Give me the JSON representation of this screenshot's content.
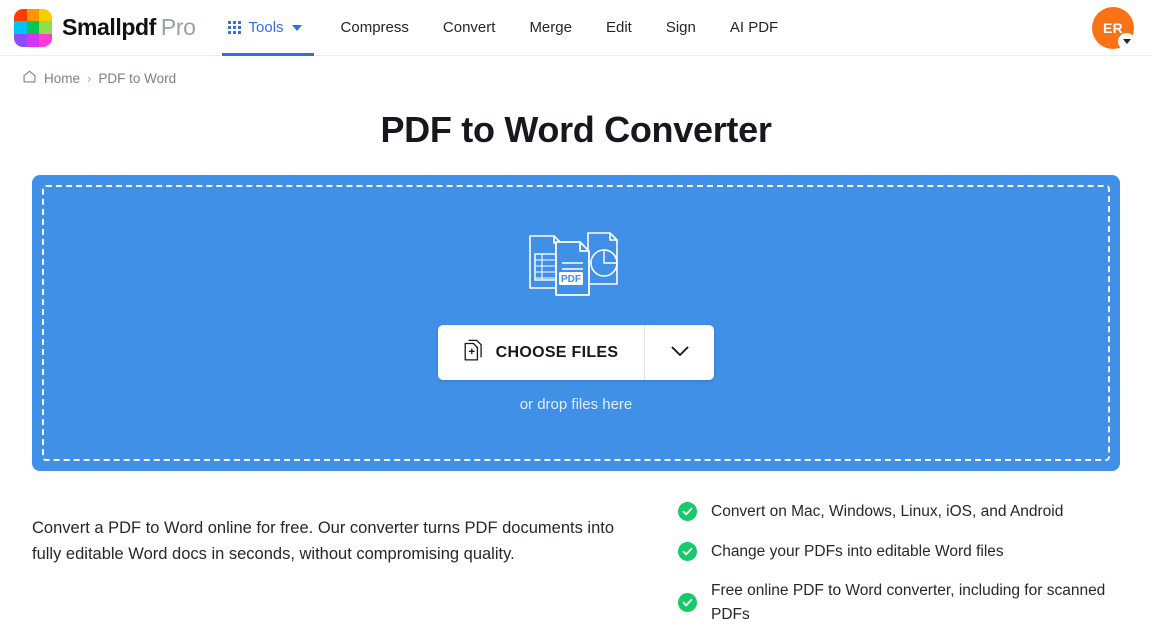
{
  "brand": {
    "name": "Smallpdf",
    "suffix": "Pro",
    "logo_colors": [
      "#ff3d00",
      "#ff9800",
      "#ffce00",
      "#00c2f5",
      "#00c853",
      "#8ede4b",
      "#8b4dff",
      "#d633f5",
      "#ff3dd4"
    ]
  },
  "nav": {
    "tools_label": "Tools",
    "items": [
      {
        "label": "Compress",
        "name": "nav-item-compress"
      },
      {
        "label": "Convert",
        "name": "nav-item-convert"
      },
      {
        "label": "Merge",
        "name": "nav-item-merge"
      },
      {
        "label": "Edit",
        "name": "nav-item-edit"
      },
      {
        "label": "Sign",
        "name": "nav-item-sign"
      },
      {
        "label": "AI PDF",
        "name": "nav-item-ai-pdf"
      }
    ],
    "accent_color": "#2f6fe4"
  },
  "account": {
    "initials": "ER",
    "avatar_color": "#f97316"
  },
  "breadcrumb": {
    "home": "Home",
    "separator": "›",
    "current": "PDF to Word"
  },
  "page": {
    "title": "PDF to Word Converter"
  },
  "dropzone": {
    "button_label": "CHOOSE FILES",
    "drop_hint": "or drop files here",
    "pdf_badge": "PDF",
    "background_color": "#4090e8"
  },
  "description": "Convert a PDF to Word online for free. Our converter turns PDF documents into fully editable Word docs in seconds, without compromising quality.",
  "features": {
    "check_color": "#18c96b",
    "items": [
      {
        "text": "Convert on Mac, Windows, Linux, iOS, and Android"
      },
      {
        "text": "Change your PDFs into editable Word files"
      },
      {
        "text": "Free online PDF to Word converter, including for scanned PDFs"
      }
    ]
  }
}
